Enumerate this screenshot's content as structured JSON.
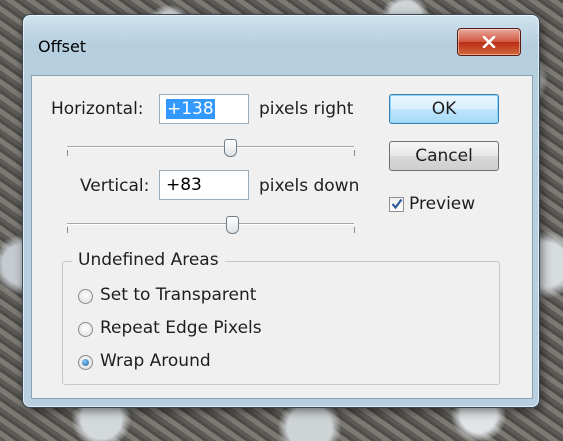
{
  "window": {
    "title": "Offset",
    "close_label": "x"
  },
  "horizontal": {
    "label": "Horizontal:",
    "value": "+138",
    "unit": "pixels right",
    "slider_level": 0.5
  },
  "vertical": {
    "label": "Vertical:",
    "value": "+83",
    "unit": "pixels down",
    "slider_level": 0.5
  },
  "buttons": {
    "ok": "OK",
    "cancel": "Cancel"
  },
  "preview": {
    "label": "Preview",
    "checked": true
  },
  "undefined_areas": {
    "title": "Undefined Areas",
    "options": [
      {
        "label": "Set to Transparent",
        "selected": false
      },
      {
        "label": "Repeat Edge Pixels",
        "selected": false
      },
      {
        "label": "Wrap Around",
        "selected": true
      }
    ]
  }
}
